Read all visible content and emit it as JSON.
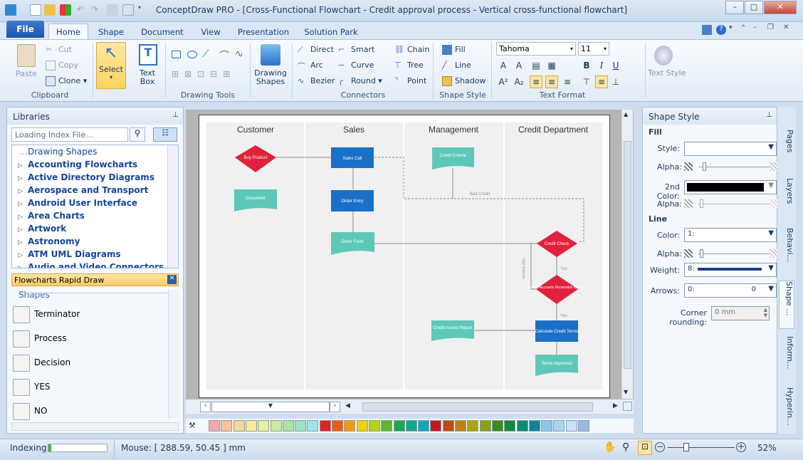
{
  "window": {
    "title": "ConceptDraw PRO - [Cross-Functional Flowchart - Credit approval process - Vertical cross-functional flowchart]"
  },
  "tabs": {
    "file": "File",
    "home": "Home",
    "shape": "Shape",
    "document": "Document",
    "view": "View",
    "presentation": "Presentation",
    "solution_park": "Solution Park"
  },
  "ribbon": {
    "clipboard": {
      "paste": "Paste",
      "cut": "Cut",
      "copy": "Copy",
      "clone": "Clone",
      "label": "Clipboard"
    },
    "select": "Select",
    "text_box": "Text Box",
    "drawing_tools": {
      "label": "Drawing Tools"
    },
    "drawing_shapes": "Drawing Shapes",
    "connectors": {
      "direct": "Direct",
      "arc": "Arc",
      "bezier": "Bezier",
      "smart": "Smart",
      "curve": "Curve",
      "round": "Round",
      "chain": "Chain",
      "tree": "Tree",
      "point": "Point",
      "label": "Connectors"
    },
    "shape_style": {
      "fill": "Fill",
      "line": "Line",
      "shadow": "Shadow",
      "label": "Shape Style"
    },
    "text_format": {
      "font": "Tahoma",
      "size": "11",
      "label": "Text Format"
    },
    "text_style": "Text Style"
  },
  "libraries": {
    "title": "Libraries",
    "search_placeholder": "Loading Index File...",
    "items": [
      "Drawing Shapes",
      "Accounting Flowcharts",
      "Active Directory Diagrams",
      "Aerospace and Transport",
      "Android User Interface",
      "Area Charts",
      "Artwork",
      "Astronomy",
      "ATM UML Diagrams",
      "Audio and Video Connectors"
    ],
    "rapid_draw": "Flowcharts Rapid Draw",
    "shapes_header": "Shapes",
    "shapes": [
      "Terminator",
      "Process",
      "Decision",
      "YES",
      "NO"
    ]
  },
  "diagram": {
    "lanes": [
      "Customer",
      "Sales",
      "Management",
      "Credit Department"
    ],
    "nodes": {
      "buy_product": "Buy Product",
      "sales_call": "Sales Call",
      "credit_criteria": "Credit Criteria",
      "document": "Document",
      "order_entry": "Order Entry",
      "order_form": "Order Form",
      "credit_check": "Credit Check",
      "review": "Review Accounts Receivable Balance",
      "credit_issued": "Credit Issued Report",
      "calc_terms": "Calculate Credit Terms",
      "terms_approved": "Terms Approved"
    },
    "labels": {
      "bad_credit": "Bad Credit",
      "yes1": "Yes",
      "yes2": "Yes",
      "high_balance": "High Balance"
    }
  },
  "shape_style_panel": {
    "title": "Shape Style",
    "fill": "Fill",
    "style": "Style:",
    "alpha": "Alpha:",
    "second_color": "2nd Color:",
    "line": "Line",
    "color": "Color:",
    "color_value": "1:",
    "weight": "Weight:",
    "weight_value": "8:",
    "arrows": "Arrows:",
    "arrows_left": "0:",
    "arrows_right": "0",
    "corner_rounding": "Corner rounding:",
    "corner_value": "0 mm"
  },
  "side_tabs": [
    "Pages",
    "Layers",
    "Behavi...",
    "Shape ...",
    "Inform...",
    "Hyperin..."
  ],
  "status": {
    "indexing": "Indexing",
    "mouse": "Mouse: [ 288.59, 50.45 ] mm",
    "zoom": "52%"
  },
  "palette_colors": [
    "#f5a8a8",
    "#f7c29a",
    "#f8d79a",
    "#f7ec9a",
    "#e4f29a",
    "#c7ec9a",
    "#a8e4a8",
    "#9ae4c8",
    "#9ae8ec",
    "#e12020",
    "#f05a0a",
    "#f39c12",
    "#f1d20a",
    "#b6d40a",
    "#5cb82a",
    "#1aa84a",
    "#11a88a",
    "#10a8b8",
    "#c01c1c",
    "#c04a10",
    "#c08010",
    "#a8a410",
    "#88a410",
    "#3a8c1a",
    "#0e8c3a",
    "#0e8c70",
    "#0e849c",
    "#88c8e8",
    "#a8d4f0",
    "#c8e0f8",
    "#98b8e8"
  ]
}
